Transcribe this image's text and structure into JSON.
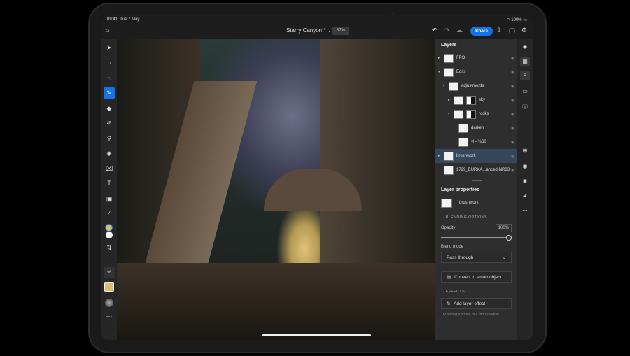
{
  "status": {
    "time": "09:41",
    "date": "Tue 7 May",
    "battery": "100%"
  },
  "topbar": {
    "title": "Starry Canyon *",
    "zoom": "37%",
    "share": "Share"
  },
  "layers": {
    "title": "Layers",
    "items": [
      {
        "name": "FPO",
        "indent": 0,
        "arrow": "▸"
      },
      {
        "name": "Edits",
        "indent": 0,
        "arrow": "▾"
      },
      {
        "name": "adjustments",
        "indent": 1,
        "arrow": "▾"
      },
      {
        "name": "sky",
        "indent": 2,
        "arrow": "▸",
        "mask": true
      },
      {
        "name": "rocks",
        "indent": 2,
        "arrow": "▾",
        "mask": true
      },
      {
        "name": "darken",
        "indent": 3,
        "arrow": ""
      },
      {
        "name": "vl - %60",
        "indent": 3,
        "arrow": ""
      },
      {
        "name": "brushwork",
        "indent": 0,
        "arrow": "▸",
        "selected": true
      },
      {
        "name": "1729_BURKA...anced-NR33",
        "indent": -1,
        "arrow": ""
      }
    ]
  },
  "properties": {
    "title": "Layer properties",
    "layer_name": "brushwork",
    "blending_section": "BLENDING OPTIONS",
    "opacity_label": "Opacity",
    "opacity_value": "100%",
    "opacity": 100,
    "blend_mode_label": "Blend mode",
    "blend_mode": "Pass through",
    "convert_button": "Convert to smart object",
    "effects_section": "EFFECTS",
    "add_effect_button": "Add layer effect",
    "hint": "Try adding a stroke or a drop shadow"
  },
  "colors": {
    "accent": "#1473e6",
    "foreground": "#e0b96a",
    "background": "#ffffff"
  }
}
